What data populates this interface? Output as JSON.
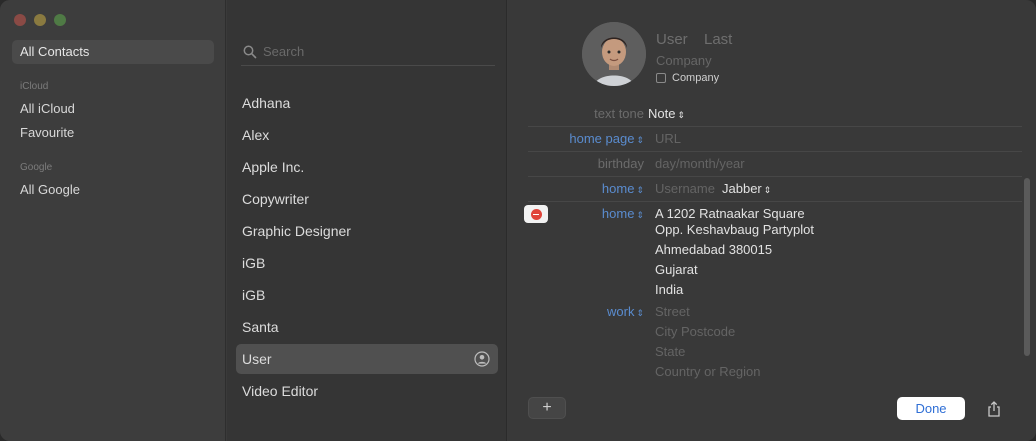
{
  "sidebar": {
    "items": [
      {
        "label": "All Contacts"
      },
      {
        "label": "All iCloud"
      },
      {
        "label": "Favourite"
      },
      {
        "label": "All Google"
      }
    ],
    "groups": {
      "icloud": "iCloud",
      "google": "Google"
    }
  },
  "list": {
    "search_placeholder": "Search",
    "contacts": [
      "Adhana",
      "Alex",
      "Apple Inc.",
      "Copywriter",
      "Graphic Designer",
      "iGB",
      "iGB",
      "Santa",
      "User",
      "Video Editor"
    ],
    "selected_index": 8
  },
  "detail": {
    "first_name_placeholder": "User",
    "last_name_placeholder": "Last",
    "company_placeholder": "Company",
    "company_checkbox_label": "Company",
    "rows": {
      "text_tone_label": "text tone",
      "text_tone_value": "Note",
      "home_page_label": "home page",
      "home_page_placeholder": "URL",
      "birthday_label": "birthday",
      "birthday_placeholder": "day/month/year",
      "im_label": "home",
      "im_username_placeholder": "Username",
      "im_service": "Jabber",
      "address_label": "home",
      "address_lines": [
        "A 1202 Ratnaakar Square",
        "Opp. Keshavbaug Partyplot",
        "Ahmedabad 380015",
        "Gujarat",
        "India"
      ],
      "work_label": "work",
      "work_placeholders": [
        "Street",
        "City Postcode",
        "State",
        "Country or Region"
      ]
    },
    "buttons": {
      "add": "+",
      "done": "Done"
    }
  },
  "colors": {
    "accent": "#2f6fd6",
    "link_label": "#5a8ccf",
    "remove": "#e0443a"
  }
}
